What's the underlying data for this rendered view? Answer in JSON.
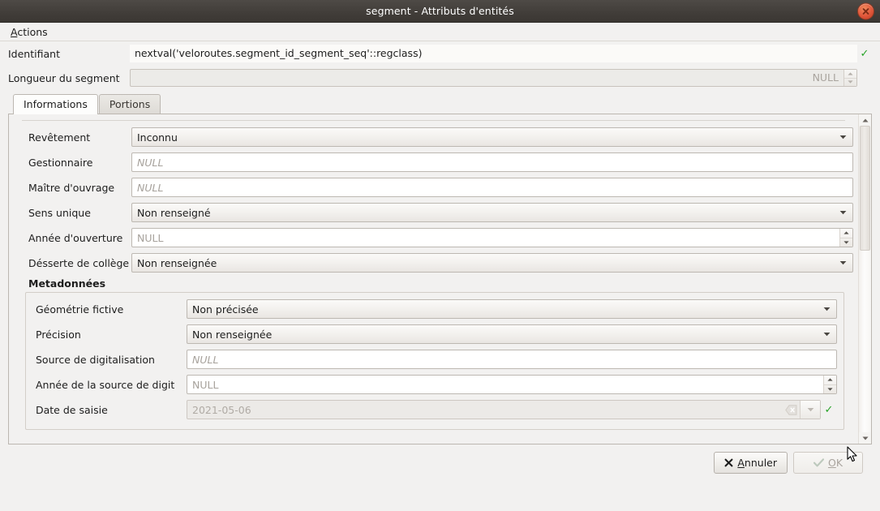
{
  "window": {
    "title": "segment - Attributs d'entités",
    "close_icon": "close-icon"
  },
  "menubar": {
    "items": [
      {
        "label": "Actions",
        "mnemonic": "A",
        "rest": "ctions"
      }
    ]
  },
  "header_fields": [
    {
      "label": "Identifiant",
      "value": "nextval('veloroutes.segment_id_segment_seq'::regclass)",
      "type": "lineedit-flat",
      "valid": "✓"
    },
    {
      "label": "Longueur du segment",
      "value": "NULL",
      "type": "spinbox-disabled",
      "disabled": true
    }
  ],
  "tabs": [
    {
      "label": "Informations",
      "active": true
    },
    {
      "label": "Portions",
      "active": false
    }
  ],
  "form": {
    "rows": [
      {
        "label": "Revêtement",
        "type": "combobox",
        "value": "Inconnu"
      },
      {
        "label": "Gestionnaire",
        "type": "lineedit",
        "value": "NULL",
        "placeholder": true
      },
      {
        "label": "Maître d'ouvrage",
        "type": "lineedit",
        "value": "NULL",
        "placeholder": true
      },
      {
        "label": "Sens unique",
        "type": "combobox",
        "value": "Non renseigné"
      },
      {
        "label": "Année d'ouverture",
        "type": "spinbox",
        "value": "NULL"
      },
      {
        "label": "Désserte de collège",
        "type": "combobox",
        "value": "Non renseignée"
      }
    ],
    "group": {
      "title": "Metadonnées",
      "rows": [
        {
          "label": "Géométrie fictive",
          "type": "combobox",
          "value": "Non précisée"
        },
        {
          "label": "Précision",
          "type": "combobox",
          "value": "Non renseignée"
        },
        {
          "label": "Source de digitalisation",
          "type": "lineedit",
          "value": "NULL",
          "placeholder": true
        },
        {
          "label": "Année de la source de digit",
          "type": "spinbox",
          "value": "NULL"
        },
        {
          "label": "Date de saisie",
          "type": "dateedit",
          "value": "2021-05-06",
          "disabled": true,
          "valid": "✓"
        }
      ]
    }
  },
  "scrollbar": {
    "up_arrow_icon": "triangle-up-icon",
    "down_arrow_icon": "triangle-down-icon",
    "thumb_position_percent": 0
  },
  "footer": {
    "cancel": {
      "label_mnemonic": "A",
      "label_rest": "nnuler",
      "icon": "cross-icon"
    },
    "ok": {
      "label_mnemonic": "O",
      "label_rest": "K",
      "icon": "check-icon",
      "disabled": true
    }
  },
  "colors": {
    "titlebar": "#413d39",
    "close": "#e0563a",
    "valid_green": "#27a327",
    "window_bg": "#f2f1f0"
  }
}
